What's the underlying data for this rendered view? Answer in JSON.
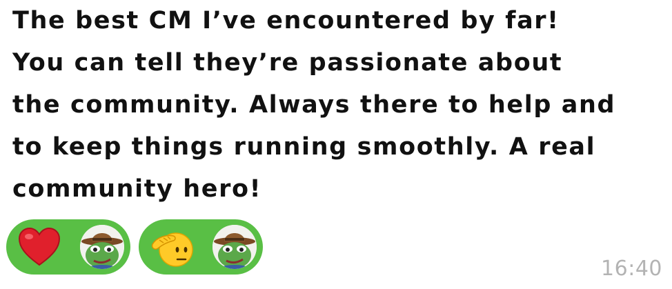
{
  "message": {
    "text": "The best CM I’ve encountered by far!\nYou can tell they’re passionate about\nthe community. Always there to help and\nto keep things running smoothly. A real\ncommunity hero!",
    "time": "16:40"
  },
  "reactions": [
    {
      "emoji": "heart-icon",
      "reactor": "frog-cowboy-avatar"
    },
    {
      "emoji": "saluting-face-icon",
      "reactor": "frog-cowboy-avatar"
    }
  ],
  "colors": {
    "reaction_chip": "#59bf45",
    "text": "#111111",
    "timestamp": "#b3b3b3",
    "heart": "#e0202c",
    "emoji_yellow": "#ffca28"
  }
}
